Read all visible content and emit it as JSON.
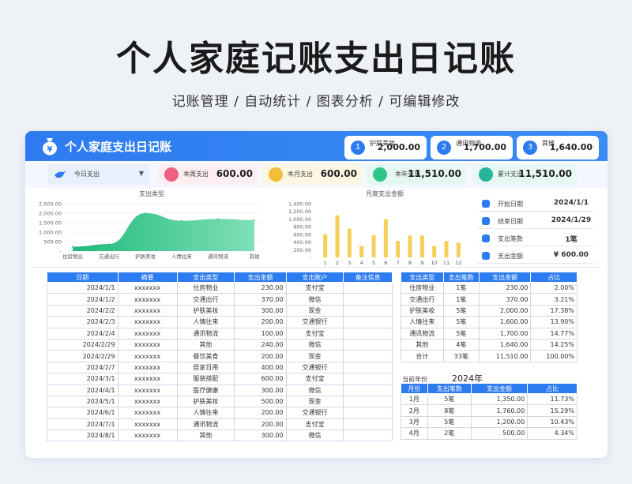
{
  "hero": {
    "title": "个人家庭记账支出日记账",
    "subtitle": "记账管理 / 自动统计 / 图表分析 / 可编辑修改"
  },
  "topbar": {
    "title": "个人家庭支出日记账",
    "pills": [
      {
        "num": "1",
        "label": "护肤美妆",
        "value": "2,000.00"
      },
      {
        "num": "2",
        "label": "通讯物流",
        "value": "1,700.00"
      },
      {
        "num": "3",
        "label": "其他",
        "value": "1,640.00"
      }
    ]
  },
  "kpis": {
    "dropdown": "今日支出",
    "week": {
      "label": "本周支出",
      "value": "600.00"
    },
    "month": {
      "label": "本月支出",
      "value": "600.00"
    },
    "year": {
      "label": "本年支出",
      "value": "11,510.00"
    },
    "total": {
      "label": "累计支出",
      "value": "11,510.00"
    }
  },
  "info": [
    {
      "label": "开始日期",
      "value": "2024/1/1"
    },
    {
      "label": "结束日期",
      "value": "2024/1/29"
    },
    {
      "label": "支出笔数",
      "value": "1笔"
    },
    {
      "label": "支出金额",
      "value": "¥ 600.00"
    }
  ],
  "chart_data": [
    {
      "type": "area",
      "title": "支出类型",
      "categories": [
        "住房物业",
        "交通出行",
        "护肤美妆",
        "人情往来",
        "通讯物流",
        "其他"
      ],
      "values": [
        230,
        370,
        2000,
        1600,
        1700,
        1640
      ],
      "y_ticks": [
        "-",
        "500.00",
        "1,000.00",
        "1,500.00",
        "2,000.00",
        "2,500.00"
      ],
      "ylim": [
        0,
        2500
      ],
      "color": "#2ec98a"
    },
    {
      "type": "bar",
      "title": "月度支出金额",
      "categories": [
        "1",
        "2",
        "3",
        "4",
        "5",
        "6",
        "7",
        "8",
        "9",
        "10",
        "11",
        "12"
      ],
      "values": [
        600,
        1100,
        750,
        300,
        580,
        1000,
        430,
        570,
        570,
        300,
        430,
        380
      ],
      "y_ticks": [
        "-",
        "200.00",
        "400.00",
        "600.00",
        "800.00",
        "1,000.00",
        "1,200.00",
        "1,400.00"
      ],
      "ylim": [
        0,
        1400
      ],
      "color": "#f4cf5a"
    }
  ],
  "ledger": {
    "headers": [
      "日期",
      "摘要",
      "支出类型",
      "支出金额",
      "支出账户",
      "备注信息"
    ],
    "rows": [
      [
        "2024/1/1",
        "xxxxxxx",
        "住房物业",
        "230.00",
        "支付宝",
        ""
      ],
      [
        "2024/1/2",
        "xxxxxxx",
        "交通出行",
        "370.00",
        "微信",
        ""
      ],
      [
        "2024/2/2",
        "xxxxxxx",
        "护肤美妆",
        "300.00",
        "现金",
        ""
      ],
      [
        "2024/2/3",
        "xxxxxxx",
        "人情往来",
        "200.00",
        "交通银行",
        ""
      ],
      [
        "2024/2/4",
        "xxxxxxx",
        "通讯物流",
        "100.00",
        "支付宝",
        ""
      ],
      [
        "2024/2/29",
        "xxxxxxx",
        "其他",
        "240.00",
        "微信",
        ""
      ],
      [
        "2024/2/29",
        "xxxxxxx",
        "餐饮美食",
        "200.00",
        "现金",
        ""
      ],
      [
        "2024/2/7",
        "xxxxxxx",
        "居家日用",
        "400.00",
        "交通银行",
        ""
      ],
      [
        "2024/3/1",
        "xxxxxxx",
        "服装搭配",
        "600.00",
        "支付宝",
        ""
      ],
      [
        "2024/4/1",
        "xxxxxxx",
        "医疗健康",
        "300.00",
        "微信",
        ""
      ],
      [
        "2024/5/1",
        "xxxxxxx",
        "护肤美妆",
        "500.00",
        "现金",
        ""
      ],
      [
        "2024/6/1",
        "xxxxxxx",
        "人情往来",
        "200.00",
        "交通银行",
        ""
      ],
      [
        "2024/7/1",
        "xxxxxxx",
        "通讯物流",
        "200.00",
        "支付宝",
        ""
      ],
      [
        "2024/8/1",
        "xxxxxxx",
        "其他",
        "300.00",
        "微信",
        ""
      ]
    ]
  },
  "summary": {
    "headers": [
      "支出类型",
      "支出笔数",
      "支出金额",
      "占比"
    ],
    "rows": [
      [
        "住房物业",
        "1笔",
        "230.00",
        "2.00%"
      ],
      [
        "交通出行",
        "1笔",
        "370.00",
        "3.21%"
      ],
      [
        "护肤美妆",
        "5笔",
        "2,000.00",
        "17.38%"
      ],
      [
        "人情往来",
        "5笔",
        "1,600.00",
        "13.90%"
      ],
      [
        "通讯物流",
        "5笔",
        "1,700.00",
        "14.77%"
      ],
      [
        "其他",
        "4笔",
        "1,640.00",
        "14.25%"
      ],
      [
        "合计",
        "33笔",
        "11,510.00",
        "100.00%"
      ]
    ]
  },
  "yearly": {
    "label": "当前年份",
    "year": "2024年",
    "headers": [
      "月份",
      "支出笔数",
      "支出金额",
      "占比"
    ],
    "rows": [
      [
        "1月",
        "5笔",
        "1,350.00",
        "11.73%"
      ],
      [
        "2月",
        "8笔",
        "1,760.00",
        "15.29%"
      ],
      [
        "3月",
        "5笔",
        "1,200.00",
        "10.43%"
      ],
      [
        "4月",
        "2笔",
        "500.00",
        "4.34%"
      ]
    ]
  }
}
